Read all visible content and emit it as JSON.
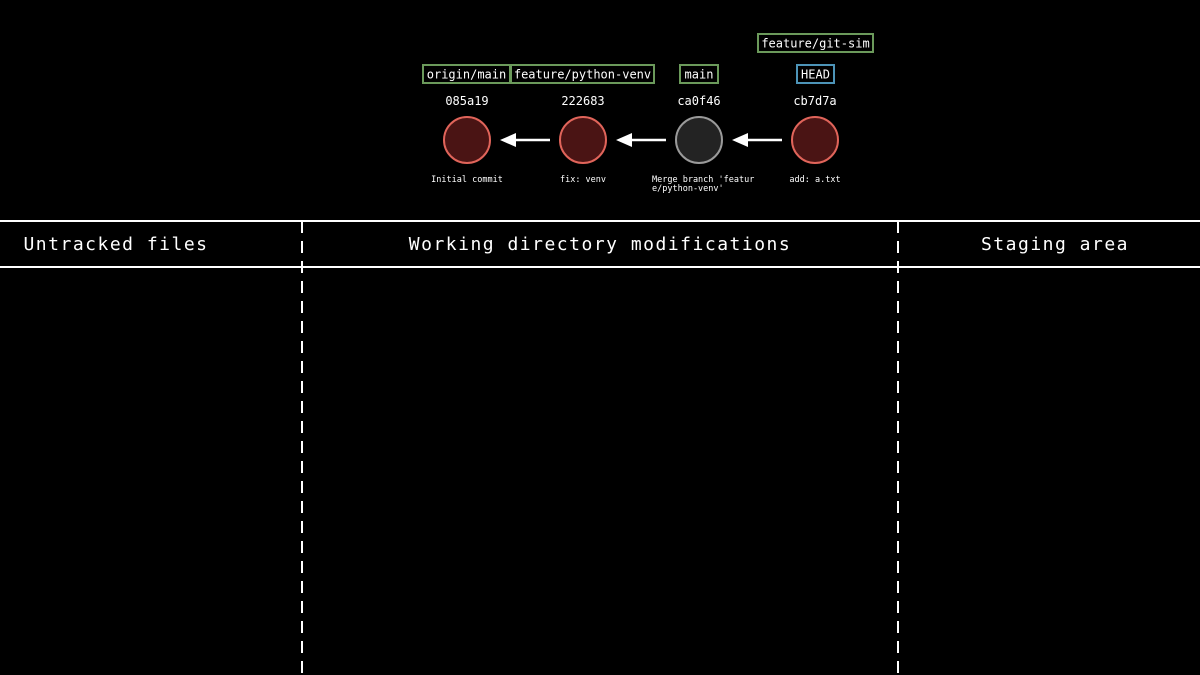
{
  "graph": {
    "commits": [
      {
        "id": "085a19",
        "message": "Initial commit",
        "message_lines": [
          "Initial commit"
        ],
        "kind": "commit"
      },
      {
        "id": "222683",
        "message": "fix: venv",
        "message_lines": [
          "fix: venv"
        ],
        "kind": "commit"
      },
      {
        "id": "ca0f46",
        "message": "Merge branch 'feature/python-venv'",
        "message_lines": [
          "Merge branch 'featur",
          "e/python-venv'"
        ],
        "kind": "merge"
      },
      {
        "id": "cb7d7a",
        "message": "add: a.txt",
        "message_lines": [
          "add: a.txt"
        ],
        "kind": "commit"
      }
    ],
    "refs": [
      {
        "label": "origin/main",
        "commit": "085a19",
        "type": "branch",
        "color": "#6b9a5b"
      },
      {
        "label": "feature/python-venv",
        "commit": "222683",
        "type": "branch",
        "color": "#6b9a5b"
      },
      {
        "label": "main",
        "commit": "ca0f46",
        "type": "branch",
        "color": "#6b9a5b"
      },
      {
        "label": "feature/git-sim",
        "commit": "cb7d7a",
        "type": "branch",
        "color": "#6b9a5b"
      },
      {
        "label": "HEAD",
        "commit": "cb7d7a",
        "type": "head",
        "color": "#4d94b8"
      }
    ],
    "colors": {
      "commit_fill": "#4a1414",
      "commit_stroke": "#e0645a",
      "merge_fill": "#232323",
      "merge_stroke": "#9a9a9a",
      "arrow": "#ffffff"
    }
  },
  "table": {
    "columns": [
      "Untracked files",
      "Working directory modifications",
      "Staging area"
    ]
  }
}
